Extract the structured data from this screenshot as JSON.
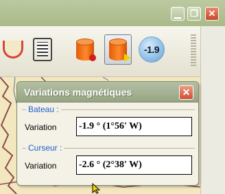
{
  "window_controls": {
    "minimize_icon": "minimize-icon",
    "maximize_icon": "maximize-icon",
    "close_icon": "close-icon"
  },
  "toolbar": {
    "value_badge": "-1.9",
    "icons": [
      "sextant-icon",
      "list-icon",
      "route-icon",
      "route-play-icon",
      "value-badge-icon"
    ]
  },
  "dialog": {
    "title": "Variations magnétiques",
    "boat": {
      "legend": "Bateau :",
      "label": "Variation",
      "value": "-1.9 ° (1°56' W)"
    },
    "cursor": {
      "legend": "Curseur :",
      "label": "Variation",
      "value": "-2.6 ° (2°38' W)"
    }
  },
  "colors": {
    "titlebar": "#a9ba88",
    "legend": "#1f5fcf",
    "close": "#cd4f33",
    "map": "#f3e7bf",
    "cylinder": "#ff8a2a"
  }
}
